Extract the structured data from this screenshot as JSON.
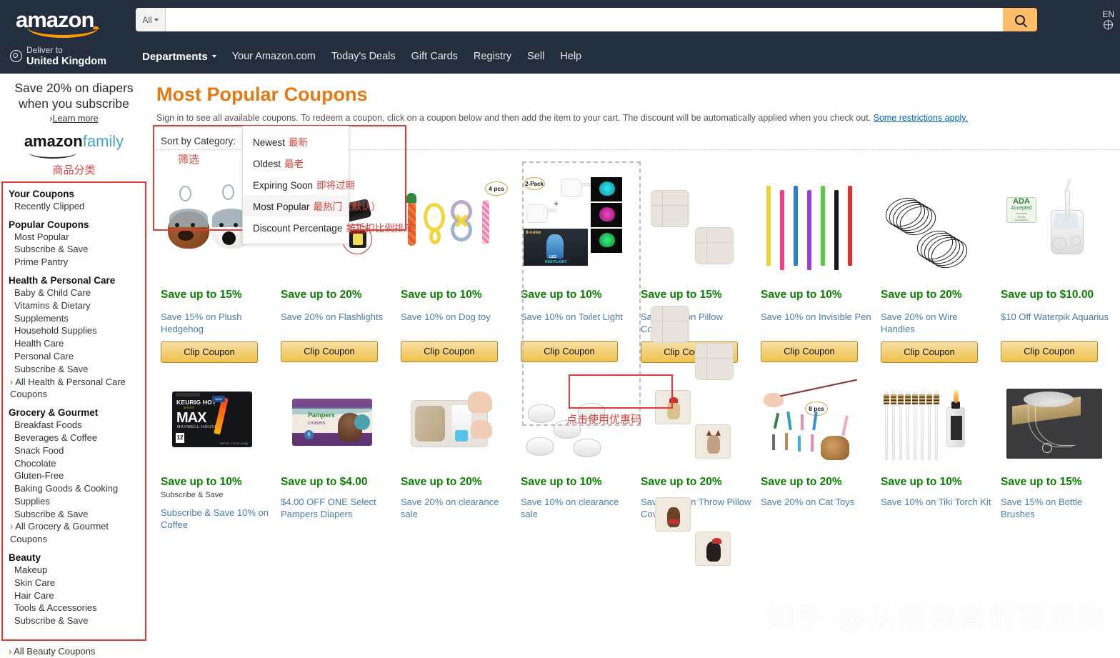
{
  "header": {
    "logo_text": "amazon",
    "search": {
      "category": "All",
      "value": "",
      "placeholder": "",
      "icon": "search-icon"
    },
    "deliver_label": "Deliver to",
    "deliver_country": "United Kingdom",
    "departments": "Departments",
    "nav_links": [
      "Your Amazon.com",
      "Today's Deals",
      "Gift Cards",
      "Registry",
      "Sell",
      "Help"
    ],
    "language": "EN",
    "accent_color": "#febd69"
  },
  "sidebar": {
    "promo_line1": "Save 20% on diapers",
    "promo_line2": "when you subscribe",
    "promo_learn": "Learn more",
    "family_logo_a": "amazon",
    "family_logo_b": "family",
    "annotation_cn": "商品分类",
    "groups": [
      {
        "head": "Your Coupons",
        "items": [
          "Recently Clipped"
        ]
      },
      {
        "head": "Popular Coupons",
        "items": [
          "Most Popular",
          "Subscribe & Save",
          "Prime Pantry"
        ]
      },
      {
        "head": "Health & Personal Care",
        "items": [
          "Baby & Child Care",
          "Vitamins & Dietary Supplements",
          "Household Supplies",
          "Health Care",
          "Personal Care",
          "Subscribe & Save"
        ],
        "all": "All Health & Personal Care Coupons"
      },
      {
        "head": "Grocery & Gourmet",
        "items": [
          "Breakfast Foods",
          "Beverages & Coffee",
          "Snack Food",
          "Chocolate",
          "Gluten-Free",
          "Baking Goods & Cooking Supplies",
          "Subscribe & Save"
        ],
        "all": "All Grocery & Gourmet Coupons"
      },
      {
        "head": "Beauty",
        "items": [
          "Makeup",
          "Skin Care",
          "Hair Care",
          "Tools & Accessories",
          "Subscribe & Save"
        ]
      }
    ],
    "below_box_all": "All Beauty Coupons"
  },
  "main": {
    "title": "Most Popular Coupons",
    "subtitle_text": "Sign in to see all available coupons. To redeem a coupon, click on a coupon below and then add the item to your cart. The discount will be automatically applied when you check out.",
    "subtitle_link": "Some restrictions apply.",
    "sort_label": "Sort by Category:",
    "sort_annotation_cn": "筛选",
    "clip_annotation_cn": "点击使用优惠码",
    "dropdown": [
      {
        "label": "Newest",
        "cn": "最新",
        "selected": false
      },
      {
        "label": "Oldest",
        "cn": "最老",
        "selected": false
      },
      {
        "label": "Expiring Soon",
        "cn": "即将过期",
        "selected": false
      },
      {
        "label": "Most Popular",
        "cn": "最热门（默认）",
        "selected": true
      },
      {
        "label": "Discount Percentage",
        "cn": "按折扣比例排序",
        "selected": false
      }
    ],
    "clip_label": "Clip Coupon",
    "row1": [
      {
        "save": "Save up to 15%",
        "sub": "",
        "desc": "Save 15% on Plush Hedgehog",
        "art": "hedgehogs"
      },
      {
        "save": "Save up to 20%",
        "sub": "",
        "desc": "Save 20% on Flashlights",
        "art": "flashlight"
      },
      {
        "save": "Save up to 10%",
        "sub": "",
        "desc": "Save 10% on Dog toy",
        "art": "dogtoys",
        "badge": "4 pcs"
      },
      {
        "save": "Save up to 10%",
        "sub": "",
        "desc": "Save 10% on Toilet Light",
        "art": "toiletlight",
        "badge": "2-Pack"
      },
      {
        "save": "Save up to 15%",
        "sub": "",
        "desc": "Save 15% on Pillow Covers",
        "art": "pillows"
      },
      {
        "save": "Save up to 10%",
        "sub": "",
        "desc": "Save 10% on Invisible Pen",
        "art": "pens"
      },
      {
        "save": "Save up to 20%",
        "sub": "",
        "desc": "Save 20% on Wire Handles",
        "art": "wires"
      },
      {
        "save": "Save up to $10.00",
        "sub": "",
        "desc": "$10 Off Waterpik Aquarius",
        "art": "waterpik",
        "ada": "ADA Accepted"
      }
    ],
    "row2": [
      {
        "save": "Save up to 10%",
        "sub": "Subscribe & Save",
        "desc": "Subscribe & Save 10% on Coffee",
        "art": "coffee"
      },
      {
        "save": "Save up to $4.00",
        "sub": "",
        "desc": "$4.00 OFF ONE Select Pampers Diapers",
        "art": "pampers"
      },
      {
        "save": "Save up to 20%",
        "sub": "",
        "desc": "Save 20% on clearance sale",
        "art": "vacbag"
      },
      {
        "save": "Save up to 10%",
        "sub": "",
        "desc": "Save 10% on clearance sale",
        "art": "lids"
      },
      {
        "save": "Save up to 20%",
        "sub": "",
        "desc": "Save 20% on Throw Pillow Covers",
        "art": "dogpillows"
      },
      {
        "save": "Save up to 20%",
        "sub": "",
        "desc": "Save 20% on Cat Toys",
        "art": "cattoy",
        "badge": "8 pcs"
      },
      {
        "save": "Save up to 10%",
        "sub": "",
        "desc": "Save 10% on Tiki Torch Kit",
        "art": "tikitorch"
      },
      {
        "save": "Save up to 15%",
        "sub": "",
        "desc": "Save 15% on Bottle Brushes",
        "art": "bottlebrush"
      }
    ]
  },
  "watermark": "知乎 @从前我真的很爱她",
  "colors": {
    "save_green": "#0a8000",
    "title_orange": "#e47911",
    "annotation_red": "#d4453e",
    "link_blue": "#0066c0"
  }
}
